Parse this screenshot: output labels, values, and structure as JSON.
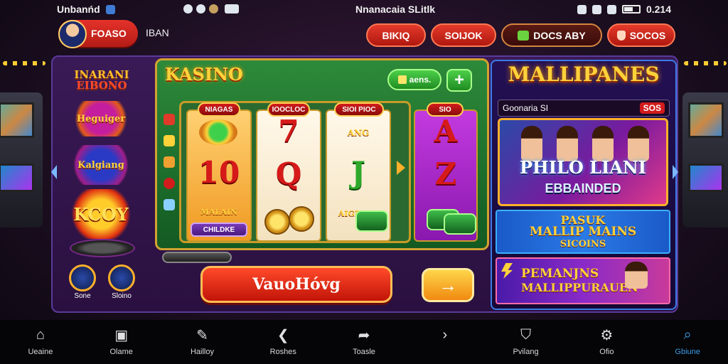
{
  "status_bar": {
    "left_text": "Unbanńd",
    "center_text": "Nnanacaia SLitlk",
    "time": "0.214",
    "icons": [
      "shield-icon",
      "record-icon",
      "gear-icon",
      "chat-icon",
      "silent-icon",
      "alarm-icon",
      "wifi-icon",
      "signal-icon",
      "battery-icon"
    ]
  },
  "header": {
    "profile_label": "FOASO",
    "username": "IBAN",
    "pills": [
      {
        "label": "BIKIQ",
        "icon": ""
      },
      {
        "label": "SOIJOK",
        "icon": ""
      },
      {
        "label": "DOCS ABY",
        "icon": "gem-icon"
      },
      {
        "label": "SOCOS",
        "icon": "hand-icon"
      }
    ]
  },
  "left_column": {
    "logos": [
      {
        "line1": "INARANI",
        "line2": "EIBONO"
      },
      {
        "text": "Heguiger"
      },
      {
        "text": "Kalgiang"
      },
      {
        "text": "KCOY"
      }
    ],
    "buttons": [
      {
        "label": "Sone",
        "icon": "user-icon"
      },
      {
        "label": "Sloino",
        "icon": "feather-icon"
      }
    ]
  },
  "slot": {
    "title": "KASINO",
    "bet_label": "aens.",
    "plus_label": "+",
    "reels": [
      {
        "tag": "NIAGAS",
        "symbols": [
          "10"
        ],
        "small": "MALAIN",
        "badge": "CHILDKE"
      },
      {
        "tag": "IOOCLOC",
        "symbols": [
          "7",
          "Q"
        ],
        "small": ""
      },
      {
        "tag": "SIOI PIOC",
        "symbols": [
          "J"
        ],
        "small": "ANG",
        "small2": "AIGIT"
      },
      {
        "tag": "SIO",
        "symbols": [
          "A",
          "Z"
        ],
        "small": ""
      }
    ],
    "spin_label": "VauoHóvg",
    "next_label": "→"
  },
  "right_panel": {
    "title": "MALLIPANES",
    "sub_left": "Goonaria SI",
    "sub_right": "SOS",
    "promo1": {
      "line1": "PHILO LIANI",
      "line2": "EBBAINDED"
    },
    "promo2": {
      "line1": "PASUK",
      "line2": "MALLIP MAINS",
      "line3": "SICOINS"
    },
    "promo3": {
      "line1": "PEMANJNS",
      "line2": "MALLIPPURAUEN"
    }
  },
  "bottom_nav": [
    {
      "label": "Ueaine",
      "icon": "home-icon",
      "glyph": "⌂",
      "active": false
    },
    {
      "label": "Olame",
      "icon": "book-icon",
      "glyph": "▣",
      "active": false
    },
    {
      "label": "Hailloy",
      "icon": "edit-icon",
      "glyph": "✎",
      "active": false
    },
    {
      "label": "Roshes",
      "icon": "back-icon",
      "glyph": "❮",
      "active": false
    },
    {
      "label": "Toasle",
      "icon": "share-icon",
      "glyph": "➦",
      "active": false
    },
    {
      "label": "",
      "icon": "chevron-right-icon",
      "glyph": "›",
      "active": false
    },
    {
      "label": "Pvilang",
      "icon": "cap-icon",
      "glyph": "⛉",
      "active": false
    },
    {
      "label": "Ofio",
      "icon": "gear-icon",
      "glyph": "⚙",
      "active": false
    },
    {
      "label": "Gbiune",
      "icon": "search-icon",
      "glyph": "⌕",
      "active": true
    }
  ],
  "colors": {
    "accent_red": "#d21c1c",
    "accent_gold": "#ffd23a",
    "felt_green": "#2d8a3a",
    "active_blue": "#3a9ee6"
  }
}
